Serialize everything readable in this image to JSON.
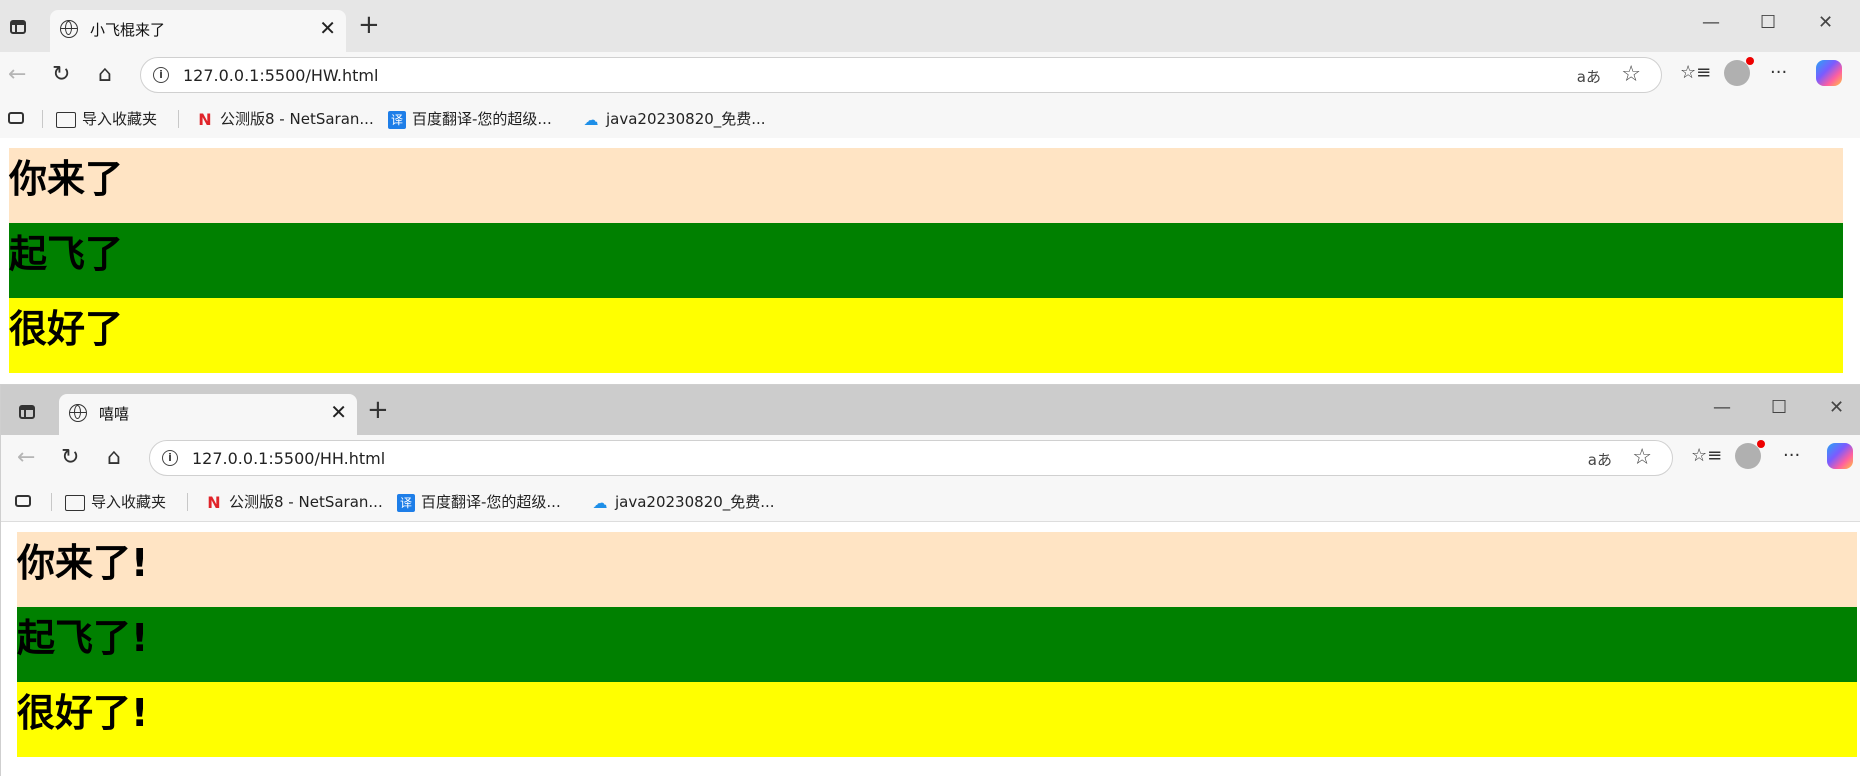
{
  "windows": [
    {
      "tab_title": "小飞棍来了",
      "url": "127.0.0.1:5500/HW.html",
      "bookmarks": [
        "导入收藏夹",
        "公测版8 - NetSaran...",
        "百度翻译-您的超级...",
        "java20230820_免费..."
      ],
      "headings": [
        "你来了",
        "起飞了",
        "很好了"
      ]
    },
    {
      "tab_title": "嘻嘻",
      "url": "127.0.0.1:5500/HH.html",
      "bookmarks": [
        "导入收藏夹",
        "公测版8 - NetSaran...",
        "百度翻译-您的超级...",
        "java20230820_免费..."
      ],
      "headings": [
        "你来了!",
        "起飞了!",
        "很好了!"
      ]
    }
  ],
  "ui": {
    "close_glyph": "✕",
    "newtab_glyph": "+",
    "minimize_glyph": "—",
    "maximize_glyph": "☐",
    "winclose_glyph": "✕",
    "back_glyph": "←",
    "reload_glyph": "↻",
    "home_glyph": "⌂",
    "info_glyph": "i",
    "read_aloud_glyph": "aあ",
    "star_glyph": "☆",
    "favorites_glyph": "☆≡",
    "more_glyph": "···",
    "translate_glyph": "译",
    "ntt_glyph": "N",
    "cloud_glyph": "☁"
  },
  "colors": {
    "band1": "#ffe4c4",
    "band2": "#008000",
    "band3": "#ffff00"
  }
}
